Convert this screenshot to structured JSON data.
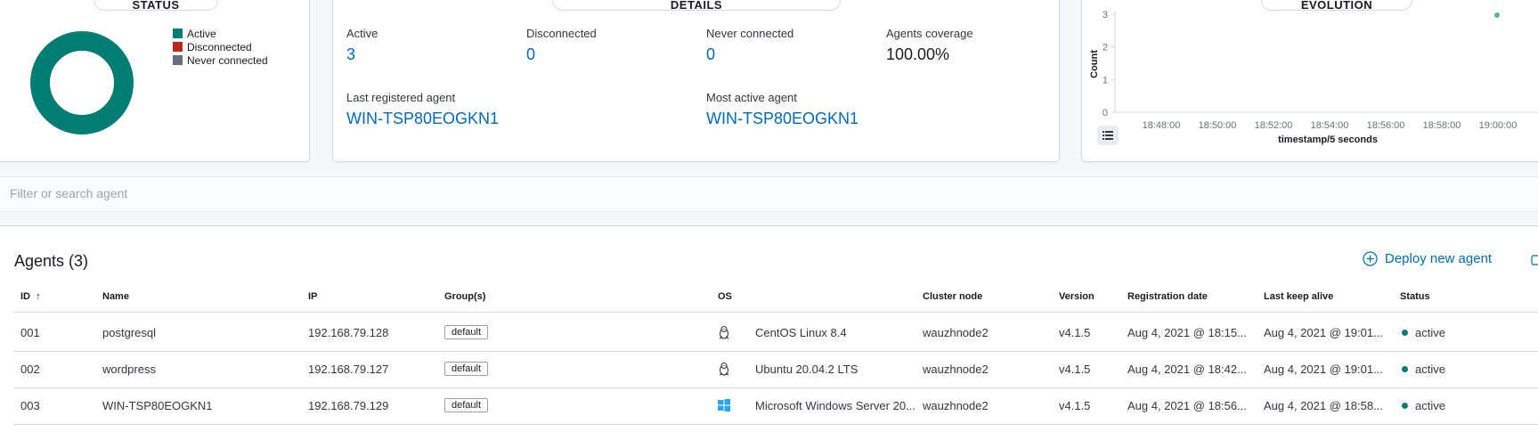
{
  "status_panel": {
    "title": "STATUS",
    "legend": [
      {
        "label": "Active",
        "color": "#017d73"
      },
      {
        "label": "Disconnected",
        "color": "#bd271e"
      },
      {
        "label": "Never connected",
        "color": "#69707d"
      }
    ],
    "donut": {
      "active": 3,
      "disconnected": 0,
      "never_connected": 0
    }
  },
  "details_panel": {
    "title": "DETAILS",
    "active_label": "Active",
    "active_value": "3",
    "disconnected_label": "Disconnected",
    "disconnected_value": "0",
    "never_label": "Never connected",
    "never_value": "0",
    "coverage_label": "Agents coverage",
    "coverage_value": "100.00%",
    "last_registered_label": "Last registered agent",
    "last_registered_value": "WIN-TSP80EOGKN1",
    "most_active_label": "Most active agent",
    "most_active_value": "WIN-TSP80EOGKN1"
  },
  "evolution_panel": {
    "title": "EVOLUTION",
    "chart_data": {
      "type": "scatter",
      "title": "",
      "xlabel": "timestamp/5 seconds",
      "ylabel": "Count",
      "ylim": [
        0,
        3
      ],
      "y_ticks": [
        "0",
        "1",
        "2",
        "3"
      ],
      "x_ticks": [
        "18:48:00",
        "18:50:00",
        "18:52:00",
        "18:54:00",
        "18:56:00",
        "18:58:00",
        "19:00:00"
      ],
      "series": [
        {
          "color": "#54b399",
          "x": [
            "19:00:00"
          ],
          "y": [
            3
          ]
        }
      ]
    }
  },
  "search": {
    "placeholder": "Filter or search agent"
  },
  "agents_table": {
    "title": "Agents (3)",
    "deploy_label": "Deploy new agent",
    "columns": [
      "ID",
      "Name",
      "IP",
      "Group(s)",
      "OS",
      "Cluster node",
      "Version",
      "Registration date",
      "Last keep alive",
      "Status"
    ],
    "sort_indicator": "↑",
    "rows": [
      {
        "id": "001",
        "name": "postgresql",
        "ip": "192.168.79.128",
        "group": "default",
        "os": "CentOS Linux 8.4",
        "os_icon": "linux-icon",
        "node": "wauzhnode2",
        "version": "v4.1.5",
        "registered": "Aug 4, 2021 @ 18:15...",
        "keepalive": "Aug 4, 2021 @ 19:01...",
        "status": "active"
      },
      {
        "id": "002",
        "name": "wordpress",
        "ip": "192.168.79.127",
        "group": "default",
        "os": "Ubuntu 20.04.2 LTS",
        "os_icon": "linux-icon",
        "node": "wauzhnode2",
        "version": "v4.1.5",
        "registered": "Aug 4, 2021 @ 18:42...",
        "keepalive": "Aug 4, 2021 @ 19:01...",
        "status": "active"
      },
      {
        "id": "003",
        "name": "WIN-TSP80EOGKN1",
        "ip": "192.168.79.129",
        "group": "default",
        "os": "Microsoft Windows Server 20...",
        "os_icon": "windows-icon",
        "node": "wauzhnode2",
        "version": "v4.1.5",
        "registered": "Aug 4, 2021 @ 18:56...",
        "keepalive": "Aug 4, 2021 @ 18:58...",
        "status": "active"
      }
    ],
    "status_color": "#017d73"
  }
}
